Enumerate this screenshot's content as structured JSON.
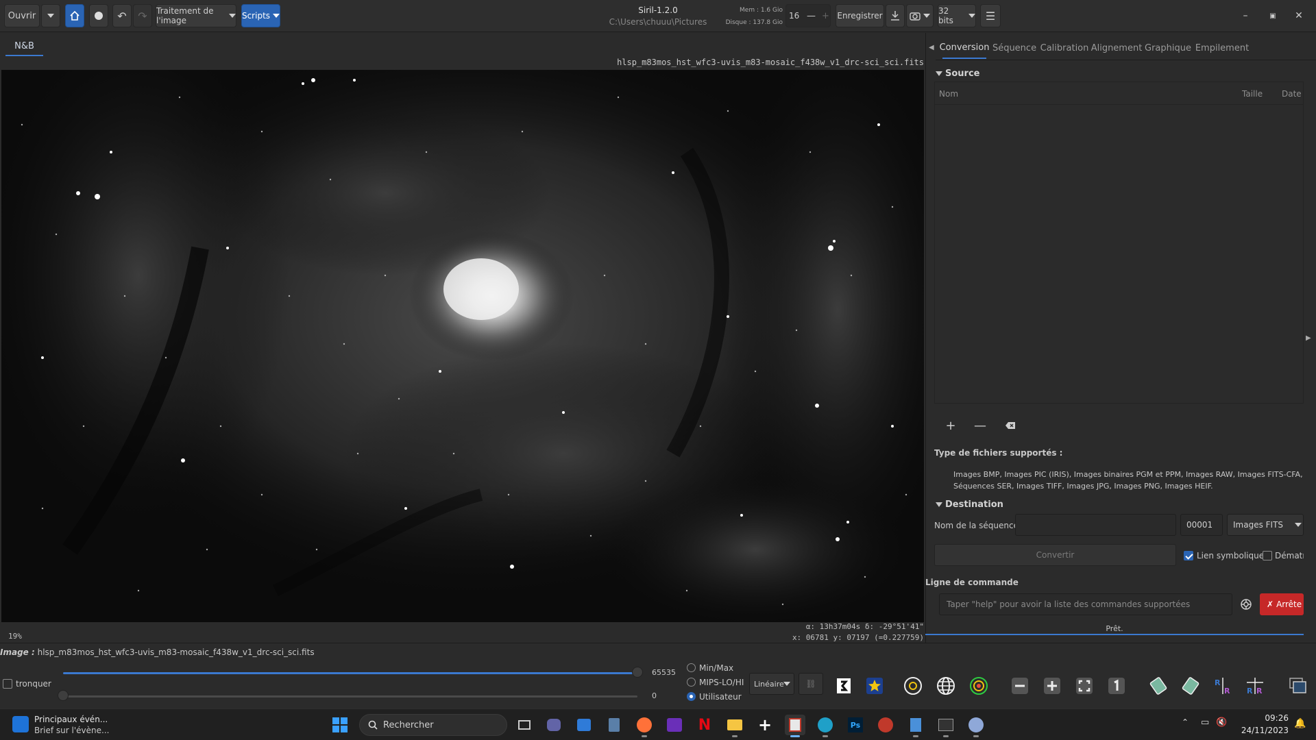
{
  "header": {
    "open_label": "Ouvrir",
    "image_processing_label": "Traitement de l'image",
    "scripts_label": "Scripts",
    "app_title": "Siril-1.2.0",
    "cwd": "C:\\Users\\chuuu\\Pictures",
    "mem_label": "Mem : 1.6 Gio",
    "disk_label": "Disque : 137.8 Gio",
    "threads_value": "16",
    "save_label": "Enregistrer",
    "bits_label": "32 bits"
  },
  "image_view": {
    "tab_label": "N&B",
    "filename": "hlsp_m83mos_hst_wfc3-uvis_m83-mosaic_f438w_v1_drc-sci_sci.fits",
    "zoom": "19%",
    "coords_line1": "α: 13h37m04s δ: -29°51'41\"",
    "coords_line2": "x: 06781 y: 07197 (=0.227759)"
  },
  "right_panel": {
    "tabs": [
      {
        "label": "Conversion",
        "active": true
      },
      {
        "label": "Séquence"
      },
      {
        "label": "Calibration"
      },
      {
        "label": "Alignement"
      },
      {
        "label": "Graphique"
      },
      {
        "label": "Empilement"
      }
    ],
    "source_title": "Source",
    "col_name": "Nom",
    "col_size": "Taille",
    "col_date": "Date",
    "supported_title": "Type de fichiers supportés :",
    "supported_line1": "Images BMP, Images PIC (IRIS), Images binaires PGM et PPM, Images RAW, Images FITS-CFA, Films",
    "supported_line2": "Séquences SER, Images TIFF, Images JPG, Images PNG, Images HEIF.",
    "destination_title": "Destination",
    "seq_name_label": "Nom de la séquence :",
    "seq_name_value": "",
    "start_index": "00001",
    "output_format": "Images FITS",
    "convert_label": "Convertir",
    "symlink_label": "Lien symbolique",
    "symlink_checked": true,
    "debayer_label": "Dématri",
    "cmdline_title": "Ligne de commande",
    "cmd_placeholder": "Taper \"help\" pour avoir la liste des commandes supportées",
    "stop_label": "Arrête",
    "status": "Prêt."
  },
  "bottom": {
    "image_label": "Image :",
    "image_file": "hlsp_m83mos_hst_wfc3-uvis_m83-mosaic_f438w_v1_drc-sci_sci.fits",
    "clip_label": "tronquer",
    "high_value": "65535",
    "low_value": "0",
    "radio_minmax": "Min/Max",
    "radio_mips": "MIPS-LO/HI",
    "radio_user": "Utilisateur",
    "scale_mode": "Linéaire"
  },
  "taskbar": {
    "news_title": "Principaux évén...",
    "news_sub": "Brief sur l'évène...",
    "search_placeholder": "Rechercher",
    "time": "09:26",
    "date": "24/11/2023"
  },
  "colors": {
    "accent": "#2a64b4",
    "tab_underline": "#3b79d0",
    "stop": "#c62828"
  }
}
